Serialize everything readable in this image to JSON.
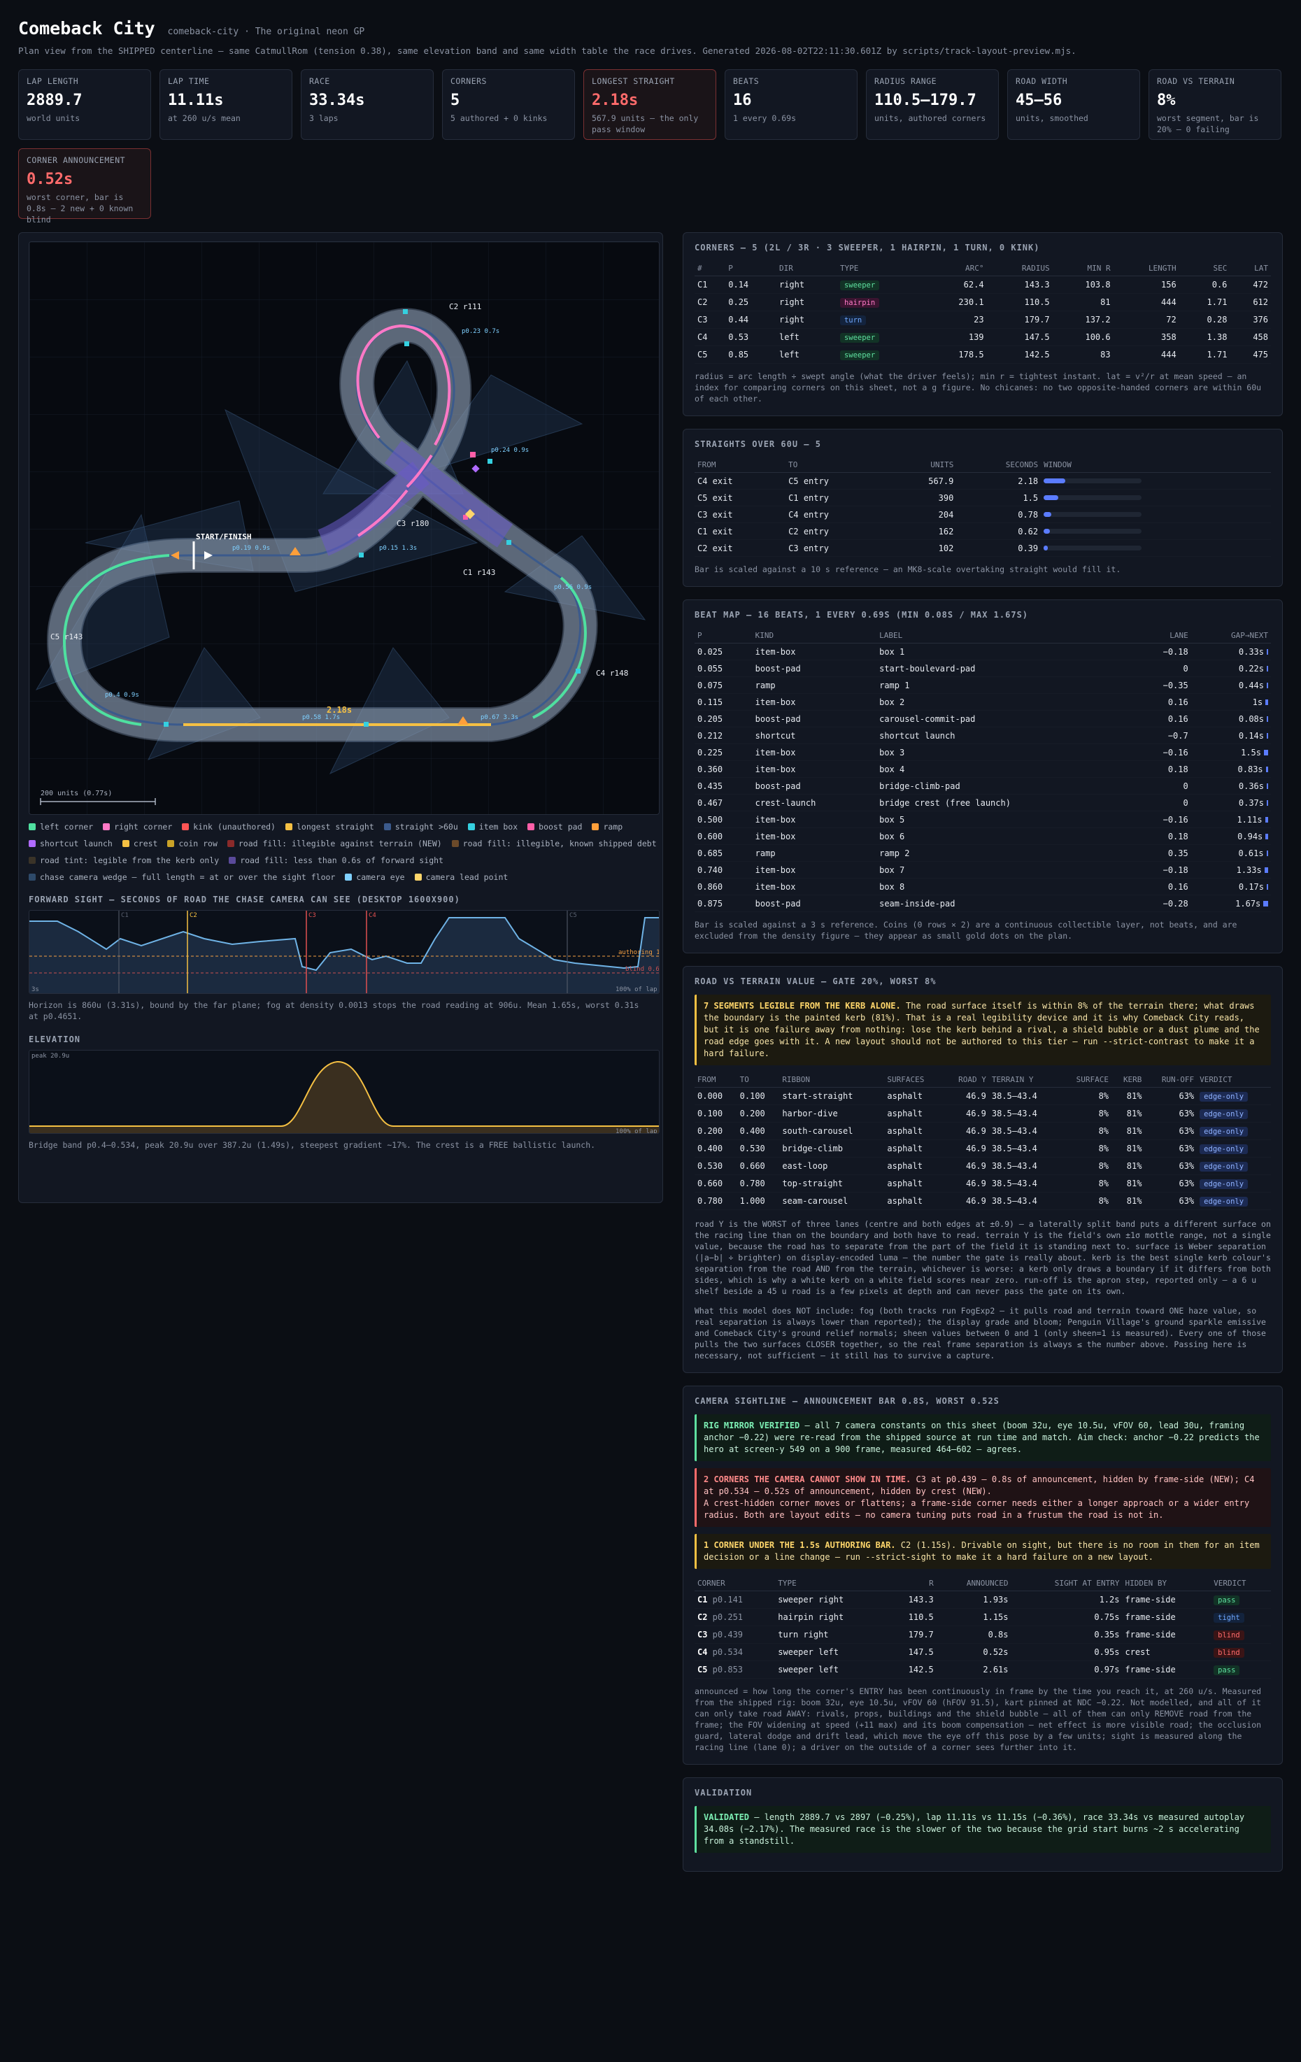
{
  "header": {
    "title": "Comeback City",
    "slug": "comeback-city · The original neon GP",
    "subtitle": "Plan view from the SHIPPED centerline — same CatmullRom (tension 0.38), same elevation band and same width table the race drives. Generated 2026-08-02T22:11:30.601Z by scripts/track-layout-preview.mjs."
  },
  "stats": [
    {
      "label": "LAP LENGTH",
      "value": "2889.7",
      "sub": "world units",
      "bad": false
    },
    {
      "label": "LAP TIME",
      "value": "11.11s",
      "sub": "at 260 u/s mean",
      "bad": false
    },
    {
      "label": "RACE",
      "value": "33.34s",
      "sub": "3 laps",
      "bad": false
    },
    {
      "label": "CORNERS",
      "value": "5",
      "sub": "5 authored + 0 kinks",
      "bad": false
    },
    {
      "label": "LONGEST STRAIGHT",
      "value": "2.18s",
      "sub": "567.9 units — the only pass window",
      "bad": true
    },
    {
      "label": "BEATS",
      "value": "16",
      "sub": "1 every 0.69s",
      "bad": false
    },
    {
      "label": "RADIUS RANGE",
      "value": "110.5–179.7",
      "sub": "units, authored corners",
      "bad": false
    },
    {
      "label": "ROAD WIDTH",
      "value": "45–56",
      "sub": "units, smoothed",
      "bad": false
    },
    {
      "label": "ROAD VS TERRAIN",
      "value": "8%",
      "sub": "worst segment, bar is 20% — 0 failing",
      "bad": false
    },
    {
      "label": "CORNER ANNOUNCEMENT",
      "value": "0.52s",
      "sub": "worst corner, bar is 0.8s — 2 new + 0 known blind",
      "bad": true
    }
  ],
  "map": {
    "corner_labels": [
      {
        "text": "C2 r111"
      },
      {
        "text": "C3 r180"
      },
      {
        "text": "C1 r143"
      },
      {
        "text": "C5 r143"
      },
      {
        "text": "C4 r148"
      }
    ],
    "start_label": "START/FINISH",
    "straight_label": "2.18s",
    "scale_label": "200 units  (0.77s)",
    "tags": [
      "p0.23 0.7s",
      "p0.24 0.9s",
      "p0.15 1.3s",
      "p0.19 0.9s",
      "p0.56 0.9s",
      "p0.58 1.7s",
      "p0.67 3.3s",
      "p0.4 0.9s"
    ]
  },
  "legend": [
    {
      "label": "left corner",
      "color": "#4fe0a0"
    },
    {
      "label": "right corner",
      "color": "#ff79c6"
    },
    {
      "label": "kink (unauthored)",
      "color": "#ff5555"
    },
    {
      "label": "longest straight",
      "color": "#f5c043"
    },
    {
      "label": "straight >60u",
      "color": "#3b5a8c"
    },
    {
      "label": "item box",
      "color": "#35d0e0"
    },
    {
      "label": "boost pad",
      "color": "#ff5fa8"
    },
    {
      "label": "ramp",
      "color": "#ff9f3a"
    },
    {
      "label": "shortcut launch",
      "color": "#b06bff"
    },
    {
      "label": "crest",
      "color": "#f5c043"
    },
    {
      "label": "coin row",
      "color": "#c9a227"
    },
    {
      "label": "road fill: illegible against terrain (NEW)",
      "color": "#8a2a2a"
    },
    {
      "label": "road fill: illegible, known shipped debt",
      "color": "#6b4a2a"
    },
    {
      "label": "road tint: legible from the kerb only",
      "color": "#3a3328"
    },
    {
      "label": "road fill: less than 0.6s of forward sight",
      "color": "#5a4a9a"
    },
    {
      "label": "chase camera wedge — full length = at or over the sight floor",
      "color": "#2e4a6a"
    },
    {
      "label": "camera eye",
      "color": "#7fd0ff"
    },
    {
      "label": "camera lead point",
      "color": "#ffd66b"
    }
  ],
  "sight": {
    "title": "FORWARD SIGHT — SECONDS OF ROAD THE CHASE CAMERA CAN SEE (DESKTOP 1600X900)",
    "y_top": "3s",
    "x_end": "100% of lap",
    "authoring": "authoring 1.5s",
    "blind": "blind 0.6s",
    "corner_marks": [
      "C1",
      "C2",
      "C3",
      "C4",
      "C5"
    ],
    "note": "Horizon is 860u (3.31s), bound by the far plane; fog at density 0.0013 stops the road reading at 906u. Mean 1.65s, worst 0.31s at p0.4651."
  },
  "elevation": {
    "title": "ELEVATION",
    "peak": "peak 20.9u",
    "x_end": "100% of lap",
    "note": "Bridge band p0.4–0.534, peak 20.9u over 387.2u (1.49s), steepest gradient ~17%. The crest is a FREE ballistic launch."
  },
  "corners": {
    "title": "CORNERS — 5 (2L / 3R · 3 SWEEPER, 1 HAIRPIN, 1 TURN, 0 KINK)",
    "headers": [
      "#",
      "P",
      "DIR",
      "TYPE",
      "ARC°",
      "RADIUS",
      "MIN R",
      "LENGTH",
      "SEC",
      "LAT"
    ],
    "rows": [
      [
        "C1",
        "0.14",
        "right",
        "sweeper",
        "62.4",
        "143.3",
        "103.8",
        "156",
        "0.6",
        "472"
      ],
      [
        "C2",
        "0.25",
        "right",
        "hairpin",
        "230.1",
        "110.5",
        "81",
        "444",
        "1.71",
        "612"
      ],
      [
        "C3",
        "0.44",
        "right",
        "turn",
        "23",
        "179.7",
        "137.2",
        "72",
        "0.28",
        "376"
      ],
      [
        "C4",
        "0.53",
        "left",
        "sweeper",
        "139",
        "147.5",
        "100.6",
        "358",
        "1.38",
        "458"
      ],
      [
        "C5",
        "0.85",
        "left",
        "sweeper",
        "178.5",
        "142.5",
        "83",
        "444",
        "1.71",
        "475"
      ]
    ],
    "note": "radius = arc length ÷ swept angle (what the driver feels); min r = tightest instant. lat = v²/r at mean speed — an index for comparing corners on this sheet, not a g figure. No chicanes: no two opposite-handed corners are within 60u of each other."
  },
  "straights": {
    "title": "STRAIGHTS OVER 60U — 5",
    "headers": [
      "FROM",
      "TO",
      "UNITS",
      "SECONDS",
      "WINDOW"
    ],
    "rows": [
      {
        "from": "C4 exit",
        "to": "C5 entry",
        "units": "567.9",
        "seconds": "2.18",
        "frac": 0.218
      },
      {
        "from": "C5 exit",
        "to": "C1 entry",
        "units": "390",
        "seconds": "1.5",
        "frac": 0.15
      },
      {
        "from": "C3 exit",
        "to": "C4 entry",
        "units": "204",
        "seconds": "0.78",
        "frac": 0.078
      },
      {
        "from": "C1 exit",
        "to": "C2 entry",
        "units": "162",
        "seconds": "0.62",
        "frac": 0.062
      },
      {
        "from": "C2 exit",
        "to": "C3 entry",
        "units": "102",
        "seconds": "0.39",
        "frac": 0.039
      }
    ],
    "note": "Bar is scaled against a 10 s reference — an MK8-scale overtaking straight would fill it."
  },
  "beats": {
    "title": "BEAT MAP — 16 BEATS, 1 EVERY 0.69S (MIN 0.08S / MAX 1.67S)",
    "headers": [
      "P",
      "KIND",
      "LABEL",
      "LANE",
      "GAP→NEXT"
    ],
    "rows": [
      {
        "p": "0.025",
        "kind": "item-box",
        "label": "box 1",
        "lane": "−0.18",
        "gap": "0.33s",
        "frac": 0.11
      },
      {
        "p": "0.055",
        "kind": "boost-pad",
        "label": "start-boulevard-pad",
        "lane": "0",
        "gap": "0.22s",
        "frac": 0.07
      },
      {
        "p": "0.075",
        "kind": "ramp",
        "label": "ramp 1",
        "lane": "−0.35",
        "gap": "0.44s",
        "frac": 0.15
      },
      {
        "p": "0.115",
        "kind": "item-box",
        "label": "box 2",
        "lane": "0.16",
        "gap": "1s",
        "frac": 0.33
      },
      {
        "p": "0.205",
        "kind": "boost-pad",
        "label": "carousel-commit-pad",
        "lane": "0.16",
        "gap": "0.08s",
        "frac": 0.03
      },
      {
        "p": "0.212",
        "kind": "shortcut",
        "label": "shortcut launch",
        "lane": "−0.7",
        "gap": "0.14s",
        "frac": 0.05
      },
      {
        "p": "0.225",
        "kind": "item-box",
        "label": "box 3",
        "lane": "−0.16",
        "gap": "1.5s",
        "frac": 0.5
      },
      {
        "p": "0.360",
        "kind": "item-box",
        "label": "box 4",
        "lane": "0.18",
        "gap": "0.83s",
        "frac": 0.28
      },
      {
        "p": "0.435",
        "kind": "boost-pad",
        "label": "bridge-climb-pad",
        "lane": "0",
        "gap": "0.36s",
        "frac": 0.12
      },
      {
        "p": "0.467",
        "kind": "crest-launch",
        "label": "bridge crest (free launch)",
        "lane": "0",
        "gap": "0.37s",
        "frac": 0.12
      },
      {
        "p": "0.500",
        "kind": "item-box",
        "label": "box 5",
        "lane": "−0.16",
        "gap": "1.11s",
        "frac": 0.37
      },
      {
        "p": "0.600",
        "kind": "item-box",
        "label": "box 6",
        "lane": "0.18",
        "gap": "0.94s",
        "frac": 0.31
      },
      {
        "p": "0.685",
        "kind": "ramp",
        "label": "ramp 2",
        "lane": "0.35",
        "gap": "0.61s",
        "frac": 0.2
      },
      {
        "p": "0.740",
        "kind": "item-box",
        "label": "box 7",
        "lane": "−0.18",
        "gap": "1.33s",
        "frac": 0.44
      },
      {
        "p": "0.860",
        "kind": "item-box",
        "label": "box 8",
        "lane": "0.16",
        "gap": "0.17s",
        "frac": 0.06
      },
      {
        "p": "0.875",
        "kind": "boost-pad",
        "label": "seam-inside-pad",
        "lane": "−0.28",
        "gap": "1.67s",
        "frac": 0.56
      }
    ],
    "note": "Bar is scaled against a 3 s reference. Coins (0 rows × 2) are a continuous collectible layer, not beats, and are excluded from the density figure — they appear as small gold dots on the plan."
  },
  "terrain": {
    "title": "ROAD VS TERRAIN VALUE — GATE 20%, WORST 8%",
    "callout_b": "7 SEGMENTS LEGIBLE FROM THE KERB ALONE.",
    "callout": " The road surface itself is within 8% of the terrain there; what draws the boundary is the painted kerb (81%). That is a real legibility device and it is why Comeback City reads, but it is one failure away from nothing: lose the kerb behind a rival, a shield bubble or a dust plume and the road edge goes with it. A new layout should not be authored to this tier — run --strict-contrast to make it a hard failure.",
    "headers": [
      "FROM",
      "TO",
      "RIBBON",
      "SURFACES",
      "ROAD Y",
      "TERRAIN Y",
      "SURFACE",
      "KERB",
      "RUN-OFF",
      "VERDICT"
    ],
    "rows": [
      [
        "0.000",
        "0.100",
        "start-straight",
        "asphalt",
        "46.9",
        "38.5–43.4",
        "8%",
        "81%",
        "63%",
        "edge-only"
      ],
      [
        "0.100",
        "0.200",
        "harbor-dive",
        "asphalt",
        "46.9",
        "38.5–43.4",
        "8%",
        "81%",
        "63%",
        "edge-only"
      ],
      [
        "0.200",
        "0.400",
        "south-carousel",
        "asphalt",
        "46.9",
        "38.5–43.4",
        "8%",
        "81%",
        "63%",
        "edge-only"
      ],
      [
        "0.400",
        "0.530",
        "bridge-climb",
        "asphalt",
        "46.9",
        "38.5–43.4",
        "8%",
        "81%",
        "63%",
        "edge-only"
      ],
      [
        "0.530",
        "0.660",
        "east-loop",
        "asphalt",
        "46.9",
        "38.5–43.4",
        "8%",
        "81%",
        "63%",
        "edge-only"
      ],
      [
        "0.660",
        "0.780",
        "top-straight",
        "asphalt",
        "46.9",
        "38.5–43.4",
        "8%",
        "81%",
        "63%",
        "edge-only"
      ],
      [
        "0.780",
        "1.000",
        "seam-carousel",
        "asphalt",
        "46.9",
        "38.5–43.4",
        "8%",
        "81%",
        "63%",
        "edge-only"
      ]
    ],
    "p1": "road Y is the WORST of three lanes (centre and both edges at ±0.9) — a laterally split band puts a different surface on the racing line than on the boundary and both have to read. terrain Y is the field's own ±1σ mottle range, not a single value, because the road has to separate from the part of the field it is standing next to. surface is Weber separation (|a−b| ÷ brighter) on display-encoded luma — the number the gate is really about. kerb is the best single kerb colour's separation from the road AND from the terrain, whichever is worse: a kerb only draws a boundary if it differs from both sides, which is why a white kerb on a white field scores near zero. run-off is the apron step, reported only — a 6 u shelf beside a 45 u road is a few pixels at depth and can never pass the gate on its own.",
    "p2": "What this model does NOT include: fog (both tracks run FogExp2 — it pulls road and terrain toward ONE haze value, so real separation is always lower than reported); the display grade and bloom; Penguin Village's ground sparkle emissive and Comeback City's ground relief normals; sheen values between 0 and 1 (only sheen=1 is measured). Every one of those pulls the two surfaces CLOSER together, so the real frame separation is always ≤ the number above. Passing here is necessary, not sufficient — it still has to survive a capture."
  },
  "camera": {
    "title": "CAMERA SIGHTLINE — ANNOUNCEMENT BAR 0.8S, WORST 0.52S",
    "c1b": "RIG MIRROR VERIFIED",
    "c1": " — all 7 camera constants on this sheet (boom 32u, eye 10.5u, vFOV 60, lead 30u, framing anchor −0.22) were re-read from the shipped source at run time and match. Aim check: anchor −0.22 predicts the hero at screen-y 549 on a 900 frame, measured 464–602 — agrees.",
    "c2b": "2 CORNERS THE CAMERA CANNOT SHOW IN TIME.",
    "c2": " C3 at p0.439 — 0.8s of announcement, hidden by frame-side (NEW); C4 at p0.534 — 0.52s of announcement, hidden by crest (NEW).",
    "c2b2": "A crest-hidden corner moves or flattens; a frame-side corner needs either a longer approach or a wider entry radius. Both are layout edits — no camera tuning puts road in a frustum the road is not in.",
    "c3b": "1 CORNER UNDER THE 1.5s AUTHORING BAR.",
    "c3": " C2 (1.15s). Drivable on sight, but there is no room in them for an item decision or a line change — run --strict-sight to make it a hard failure on a new layout.",
    "headers": [
      "CORNER",
      "TYPE",
      "R",
      "ANNOUNCED",
      "SIGHT AT ENTRY",
      "HIDDEN BY",
      "VERDICT"
    ],
    "rows": [
      {
        "c": "C1",
        "p": "p0.141",
        "type": "sweeper right",
        "r": "143.3",
        "ann": "1.93s",
        "sight": "1.2s",
        "hid": "frame-side",
        "v": "pass"
      },
      {
        "c": "C2",
        "p": "p0.251",
        "type": "hairpin right",
        "r": "110.5",
        "ann": "1.15s",
        "sight": "0.75s",
        "hid": "frame-side",
        "v": "tight"
      },
      {
        "c": "C3",
        "p": "p0.439",
        "type": "turn right",
        "r": "179.7",
        "ann": "0.8s",
        "sight": "0.35s",
        "hid": "frame-side",
        "v": "blind"
      },
      {
        "c": "C4",
        "p": "p0.534",
        "type": "sweeper left",
        "r": "147.5",
        "ann": "0.52s",
        "sight": "0.95s",
        "hid": "crest",
        "v": "blind"
      },
      {
        "c": "C5",
        "p": "p0.853",
        "type": "sweeper left",
        "r": "142.5",
        "ann": "2.61s",
        "sight": "0.97s",
        "hid": "frame-side",
        "v": "pass"
      }
    ],
    "note": "announced = how long the corner's ENTRY has been continuously in frame by the time you reach it, at 260 u/s. Measured from the shipped rig: boom 32u, eye 10.5u, vFOV 60 (hFOV 91.5), kart pinned at NDC −0.22. Not modelled, and all of it can only take road AWAY: rivals, props, buildings and the shield bubble — all of them can only REMOVE road from the frame; the FOV widening at speed (+11 max) and its boom compensation — net effect is more visible road; the occlusion guard, lateral dodge and drift lead, which move the eye off this pose by a few units; sight is measured along the racing line (lane 0); a driver on the outside of a corner sees further into it."
  },
  "validation": {
    "title": "VALIDATION",
    "b": "VALIDATED",
    "text": " — length 2889.7 vs 2897 (−0.25%), lap 11.11s vs 11.15s (−0.36%), race 33.34s vs measured autoplay 34.08s (−2.17%). The measured race is the slower of the two because the grid start burns ~2 s accelerating from a standstill."
  }
}
